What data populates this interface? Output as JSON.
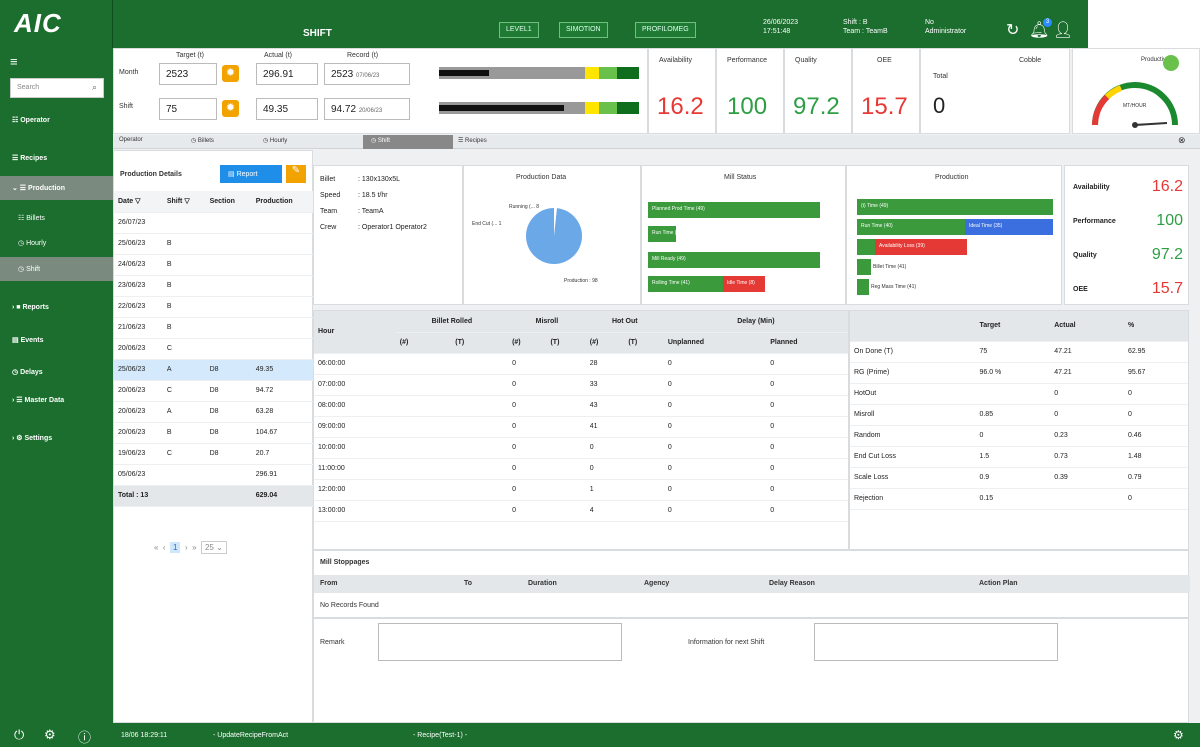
{
  "logo": {
    "text": "AIC"
  },
  "header": {
    "title": "SHIFT",
    "buttons": [
      "LEVEL1",
      "SIMOTION",
      "PROFILOMEG"
    ],
    "datetime": [
      "26/06/2023",
      "17:51:48"
    ],
    "shift": [
      "Shift : B",
      "Team : TeamB"
    ],
    "user": [
      "No",
      "Administrator"
    ],
    "notification_count": "3"
  },
  "sidebar": {
    "search_placeholder": "Search",
    "items": [
      {
        "label": "Operator"
      },
      {
        "label": "Recipes"
      },
      {
        "label": "Production"
      },
      {
        "label": "Billets"
      },
      {
        "label": "Hourly"
      },
      {
        "label": "Shift"
      },
      {
        "label": "Reports"
      },
      {
        "label": "Events"
      },
      {
        "label": "Delays"
      },
      {
        "label": "Master Data"
      },
      {
        "label": "Settings"
      }
    ]
  },
  "targets": {
    "col_target": "Target (t)",
    "col_actual": "Actual (t)",
    "col_record": "Record (t)",
    "rows": [
      {
        "label": "Month",
        "target": "2523",
        "actual": "296.91",
        "record": "2523",
        "record_date": "07/06/23"
      },
      {
        "label": "Shift",
        "target": "75",
        "actual": "49.35",
        "record": "94.72",
        "record_date": "20/06/23"
      }
    ]
  },
  "kpis": [
    {
      "label": "Availability",
      "value": "16.2",
      "color": "#e53935"
    },
    {
      "label": "Performance",
      "value": "100",
      "color": "#2e9e44"
    },
    {
      "label": "Quality",
      "value": "97.2",
      "color": "#2e9e44"
    },
    {
      "label": "OEE",
      "value": "15.7",
      "color": "#e53935"
    },
    {
      "label": "Cobble",
      "sublabel": "Total",
      "value": "0",
      "color": "#222"
    }
  ],
  "productivity": {
    "label": "Productivity",
    "unit": "MT/HOUR"
  },
  "tabs": [
    "Operator",
    "Billets",
    "Hourly",
    "Shift",
    "Recipes"
  ],
  "production_details": {
    "title": "Production Details",
    "report_btn": "Report",
    "columns": [
      "Date",
      "Shift",
      "Section",
      "Production"
    ],
    "rows": [
      [
        "26/07/23",
        "",
        "",
        ""
      ],
      [
        "25/06/23",
        "B",
        "",
        ""
      ],
      [
        "24/06/23",
        "B",
        "",
        ""
      ],
      [
        "23/06/23",
        "B",
        "",
        ""
      ],
      [
        "22/06/23",
        "B",
        "",
        ""
      ],
      [
        "21/06/23",
        "B",
        "",
        ""
      ],
      [
        "20/06/23",
        "C",
        "",
        ""
      ],
      [
        "25/06/23",
        "A",
        "D8",
        "49.35"
      ],
      [
        "20/06/23",
        "C",
        "D8",
        "94.72"
      ],
      [
        "20/06/23",
        "A",
        "D8",
        "63.28"
      ],
      [
        "20/06/23",
        "B",
        "D8",
        "104.67"
      ],
      [
        "19/06/23",
        "C",
        "D8",
        "20.7"
      ],
      [
        "05/06/23",
        "",
        "",
        "296.91"
      ]
    ],
    "total_label": "Total : 13",
    "total_value": "629.04",
    "pager": {
      "page": "1",
      "size": "25"
    }
  },
  "shift_info": [
    {
      "k": "Billet",
      "v": "130x130x5L"
    },
    {
      "k": "Speed",
      "v": "18.5 t/hr"
    },
    {
      "k": "Team",
      "v": "TeamA"
    },
    {
      "k": "Crew",
      "v": "Operator1 Operator2"
    }
  ],
  "production_data": {
    "title": "Production Data",
    "labels": [
      "Running (...  8",
      "End Cut (... 1",
      "Production : 98"
    ]
  },
  "mill_status": {
    "title": "Mill Status",
    "bars": [
      "Planned Prod Time (49)",
      "Run Time (40)",
      "Mill Ready (49)",
      "Rolling Time (41)",
      "Idle Time (8)"
    ]
  },
  "production_bars": {
    "title": "Production",
    "bars": [
      "(t) Time (49)",
      "Run Time (40)",
      "Ideal Time (35)",
      "Availability Loss (39)",
      "Billet Time (41)",
      "Reg Mass Time (41)"
    ]
  },
  "kpi_side": [
    {
      "label": "Availability",
      "value": "16.2",
      "color": "#e53935"
    },
    {
      "label": "Performance",
      "value": "100",
      "color": "#2e9e44"
    },
    {
      "label": "Quality",
      "value": "97.2",
      "color": "#2e9e44"
    },
    {
      "label": "OEE",
      "value": "15.7",
      "color": "#e53935"
    }
  ],
  "hourly": {
    "groups": [
      "Billet Rolled",
      "Misroll",
      "Hot Out",
      "Delay (Min)"
    ],
    "sub": [
      "(#)",
      "(T)",
      "(#)",
      "(T)",
      "(#)",
      "(T)",
      "Unplanned",
      "Planned"
    ],
    "hour_label": "Hour",
    "rows": [
      [
        "06:00:00",
        "",
        "",
        "0",
        "",
        "28",
        "",
        "0",
        "0"
      ],
      [
        "07:00:00",
        "",
        "",
        "0",
        "",
        "33",
        "",
        "0",
        "0"
      ],
      [
        "08:00:00",
        "",
        "",
        "0",
        "",
        "43",
        "",
        "0",
        "0"
      ],
      [
        "09:00:00",
        "",
        "",
        "0",
        "",
        "41",
        "",
        "0",
        "0"
      ],
      [
        "10:00:00",
        "",
        "",
        "0",
        "",
        "0",
        "",
        "0",
        "0"
      ],
      [
        "11:00:00",
        "",
        "",
        "0",
        "",
        "0",
        "",
        "0",
        "0"
      ],
      [
        "12:00:00",
        "",
        "",
        "0",
        "",
        "1",
        "",
        "0",
        "0"
      ],
      [
        "13:00:00",
        "",
        "",
        "0",
        "",
        "4",
        "",
        "0",
        "0"
      ]
    ]
  },
  "losses": {
    "columns": [
      "",
      "Target",
      "Actual",
      "%"
    ],
    "rows": [
      [
        "On Done (T)",
        "75",
        "47.21",
        "62.95"
      ],
      [
        "RG (Prime)",
        "96.0 %",
        "47.21",
        "95.67"
      ],
      [
        "HotOut",
        "",
        "0",
        "0"
      ],
      [
        "Misroll",
        "0.85",
        "0",
        "0"
      ],
      [
        "Random",
        "0",
        "0.23",
        "0.46"
      ],
      [
        "End Cut Loss",
        "1.5",
        "0.73",
        "1.48"
      ],
      [
        "Scale Loss",
        "0.9",
        "0.39",
        "0.79"
      ],
      [
        "Rejection",
        "0.15",
        "",
        "0"
      ]
    ]
  },
  "stoppages": {
    "title": "Mill Stoppages",
    "columns": [
      "From",
      "To",
      "Duration",
      "Agency",
      "Delay Reason",
      "Action Plan"
    ],
    "empty": "No Records Found"
  },
  "remark": {
    "label": "Remark",
    "next_label": "Information for next Shift"
  },
  "statusbar": {
    "time": "18/06 18:29:11",
    "msg1": "UpdateRecipeFromAct",
    "msg2": "Recipe(Test-1)"
  }
}
